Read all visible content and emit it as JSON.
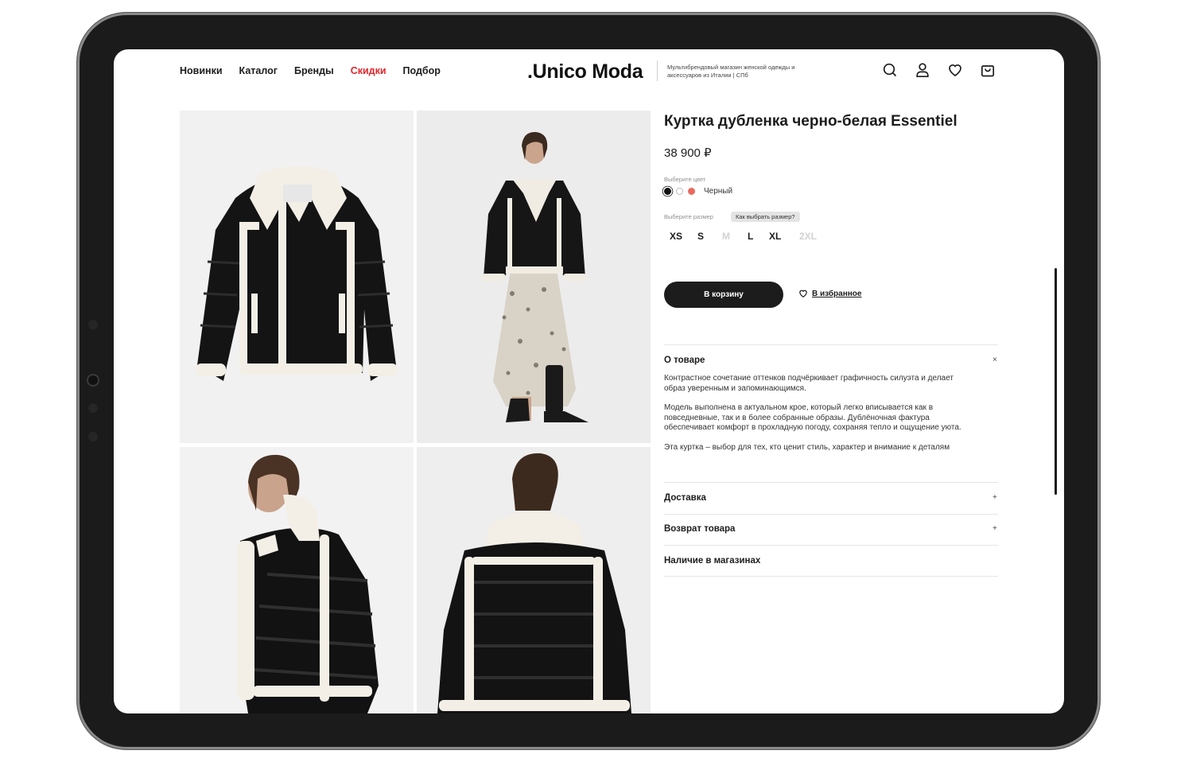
{
  "header": {
    "nav": [
      {
        "label": "Новинки",
        "highlight": false
      },
      {
        "label": "Каталог",
        "highlight": false
      },
      {
        "label": "Бренды",
        "highlight": false
      },
      {
        "label": "Скидки",
        "highlight": true
      },
      {
        "label": "Подбор",
        "highlight": false
      }
    ],
    "logo": ".Unico Moda",
    "tagline": "Мультибрендовый магазин женской одежды и аксессуаров из Италии | СПб",
    "icons": [
      "search-icon",
      "user-icon",
      "heart-icon",
      "bag-icon"
    ]
  },
  "product": {
    "title": "Куртка дубленка черно-белая Essentiel",
    "price": "38 900 ₽",
    "color_label": "Выберите цвет",
    "color_name": "Черный",
    "colors": [
      "#111111",
      "#ffffff",
      "#e86a5e"
    ],
    "size_label": "Выберите размер",
    "size_help": "Как выбрать размер?",
    "sizes": [
      {
        "label": "XS",
        "available": true
      },
      {
        "label": "S",
        "available": true
      },
      {
        "label": "M",
        "available": false
      },
      {
        "label": "L",
        "available": true
      },
      {
        "label": "XL",
        "available": true
      },
      {
        "label": "2XL",
        "available": false
      }
    ],
    "add_to_cart": "В корзину",
    "add_to_favorites": "В избранное"
  },
  "accordion": [
    {
      "title": "О товаре",
      "toggle": "×",
      "paragraphs": [
        "Контрастное сочетание оттенков подчёркивает графичность силуэта и делает образ уверенным и запоминающимся.",
        "Модель выполнена в актуальном крое, который легко вписывается как в повседневные, так и в более собранные образы. Дублёночная фактура обеспечивает комфорт в прохладную погоду, сохраняя тепло и ощущение уюта.",
        "Эта куртка – выбор для тех, кто ценит стиль, характер и внимание к деталям"
      ]
    },
    {
      "title": "Доставка",
      "toggle": "+"
    },
    {
      "title": "Возврат товара",
      "toggle": "+"
    },
    {
      "title": "Наличие в магазинах",
      "toggle": ""
    }
  ]
}
